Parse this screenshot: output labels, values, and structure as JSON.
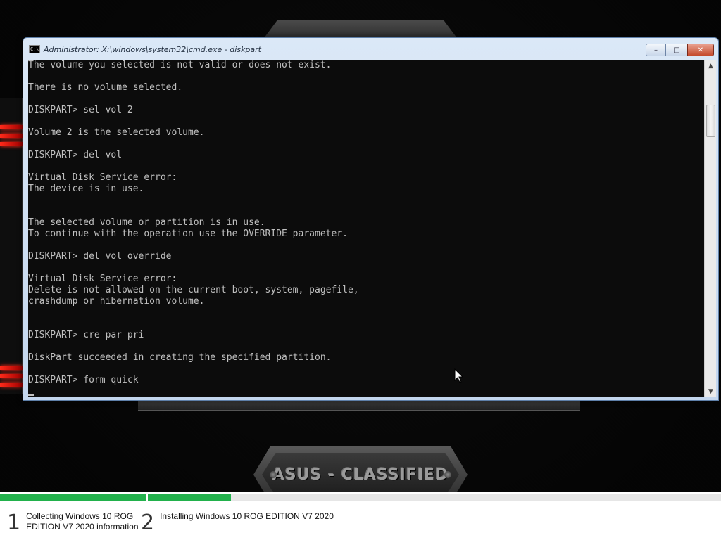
{
  "window": {
    "title": "Administrator: X:\\windows\\system32\\cmd.exe - diskpart",
    "icon": "cmd-icon",
    "icon_glyph": "C:\\",
    "controls": {
      "minimize": "–",
      "maximize": "□",
      "close": "✕"
    }
  },
  "console": {
    "lines": [
      "The volume you selected is not valid or does not exist.",
      "",
      "There is no volume selected.",
      "",
      "DISKPART> sel vol 2",
      "",
      "Volume 2 is the selected volume.",
      "",
      "DISKPART> del vol",
      "",
      "Virtual Disk Service error:",
      "The device is in use.",
      "",
      "",
      "The selected volume or partition is in use.",
      "To continue with the operation use the OVERRIDE parameter.",
      "",
      "DISKPART> del vol override",
      "",
      "Virtual Disk Service error:",
      "Delete is not allowed on the current boot, system, pagefile,",
      "crashdump or hibernation volume.",
      "",
      "",
      "DISKPART> cre par pri",
      "",
      "DiskPart succeeded in creating the specified partition.",
      "",
      "DISKPART> form quick"
    ],
    "text_color": "#c0c0c0",
    "background": "#0c0c0c"
  },
  "scrollbar": {
    "up_arrow": "▲",
    "down_arrow": "▼"
  },
  "background": {
    "badge_text": "ASUS - CLASSIFIED",
    "accent_red": "#ff2a1a"
  },
  "setup_progress": {
    "fill_color": "#22b14c",
    "step1_fraction": 1.0,
    "step2_fraction": 0.145,
    "steps": [
      {
        "number": "1",
        "label_line1": "Collecting Windows 10 ROG",
        "label_line2": "EDITION V7 2020 information"
      },
      {
        "number": "2",
        "label_line1": "Installing Windows 10 ROG EDITION V7 2020",
        "label_line2": ""
      }
    ]
  }
}
